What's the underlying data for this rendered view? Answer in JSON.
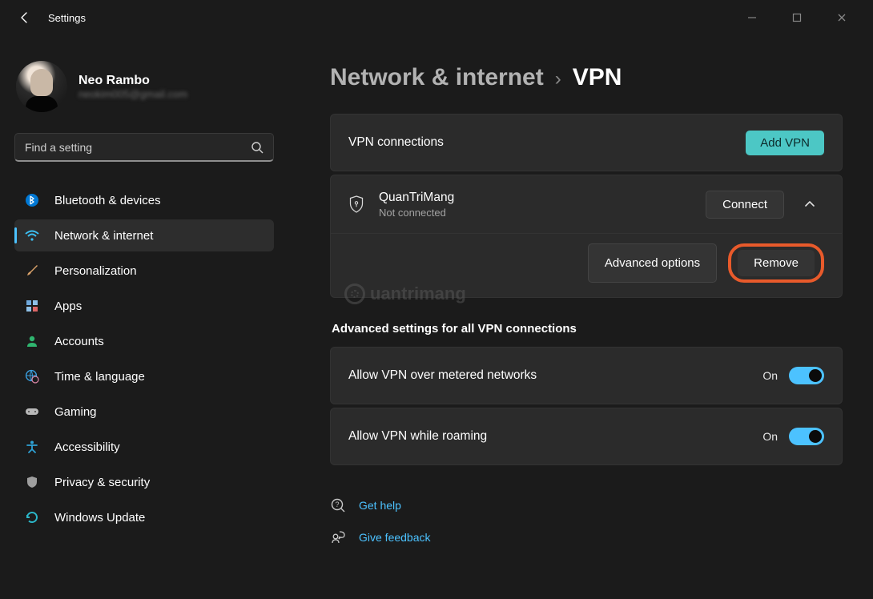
{
  "window": {
    "title": "Settings"
  },
  "profile": {
    "name": "Neo Rambo",
    "email": "neokim005@gmail.com"
  },
  "search": {
    "placeholder": "Find a setting"
  },
  "sidebar": {
    "items": [
      {
        "label": "Bluetooth & devices",
        "icon": "bluetooth-icon",
        "color": "#0078d4"
      },
      {
        "label": "Network & internet",
        "icon": "wifi-icon",
        "color": "#3cbff2",
        "active": true
      },
      {
        "label": "Personalization",
        "icon": "brush-icon",
        "color": "#d9a26a"
      },
      {
        "label": "Apps",
        "icon": "apps-icon",
        "color": "#6fa8dc"
      },
      {
        "label": "Accounts",
        "icon": "person-icon",
        "color": "#2fb56f"
      },
      {
        "label": "Time & language",
        "icon": "globe-clock-icon",
        "color": "#3aa0e0"
      },
      {
        "label": "Gaming",
        "icon": "gamepad-icon",
        "color": "#b9b9b9"
      },
      {
        "label": "Accessibility",
        "icon": "accessibility-icon",
        "color": "#2fa2d6"
      },
      {
        "label": "Privacy & security",
        "icon": "shield-icon",
        "color": "#9e9e9e"
      },
      {
        "label": "Windows Update",
        "icon": "update-icon",
        "color": "#2bb7c9"
      }
    ]
  },
  "breadcrumb": {
    "parent": "Network & internet",
    "current": "VPN"
  },
  "vpn_header": {
    "title": "VPN connections",
    "add_button": "Add VPN"
  },
  "vpn_item": {
    "name": "QuanTriMang",
    "status": "Not connected",
    "connect_button": "Connect",
    "advanced_button": "Advanced options",
    "remove_button": "Remove"
  },
  "advanced_heading": "Advanced settings for all VPN connections",
  "setting_metered": {
    "label": "Allow VPN over metered networks",
    "state_text": "On",
    "on": true
  },
  "setting_roaming": {
    "label": "Allow VPN while roaming",
    "state_text": "On",
    "on": true
  },
  "help": {
    "get_help": "Get help",
    "give_feedback": "Give feedback"
  },
  "watermark": "uantrimang"
}
